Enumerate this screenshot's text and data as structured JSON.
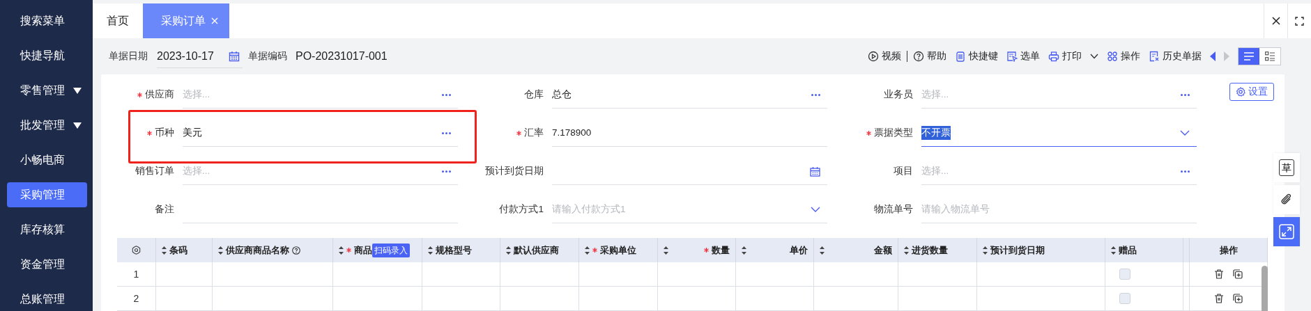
{
  "sidebar": {
    "items": [
      {
        "label": "搜索菜单",
        "selected": false,
        "expandable": false
      },
      {
        "label": "快捷导航",
        "selected": false,
        "expandable": false
      },
      {
        "label": "零售管理",
        "selected": false,
        "expandable": true
      },
      {
        "label": "批发管理",
        "selected": false,
        "expandable": true
      },
      {
        "label": "小畅电商",
        "selected": false,
        "expandable": false
      },
      {
        "label": "采购管理",
        "selected": true,
        "expandable": false
      },
      {
        "label": "库存核算",
        "selected": false,
        "expandable": false
      },
      {
        "label": "资金管理",
        "selected": false,
        "expandable": false
      },
      {
        "label": "总账管理",
        "selected": false,
        "expandable": false
      }
    ]
  },
  "tabs": [
    {
      "label": "首页",
      "selected": false,
      "closable": false
    },
    {
      "label": "采购订单",
      "selected": true,
      "closable": true
    }
  ],
  "document": {
    "date_label": "单据日期",
    "date": "2023-10-17",
    "code_label": "单据编码",
    "code": "PO-20231017-001"
  },
  "toolbar": [
    {
      "kind": "video",
      "label": "视频",
      "dropdown": false
    },
    {
      "kind": "divider"
    },
    {
      "kind": "help",
      "label": "帮助",
      "dropdown": false
    },
    {
      "kind": "shortcut",
      "label": "快捷键",
      "dropdown": false
    },
    {
      "kind": "pick",
      "label": "选单",
      "dropdown": false
    },
    {
      "kind": "print",
      "label": "打印",
      "dropdown": true
    },
    {
      "kind": "operate",
      "label": "操作",
      "dropdown": false
    },
    {
      "kind": "history",
      "label": "历史单据",
      "dropdown": false
    }
  ],
  "pager": {
    "prev_disabled": false,
    "next_disabled": true
  },
  "view_modes": [
    {
      "kind": "list",
      "selected": true
    },
    {
      "kind": "detail",
      "selected": false
    }
  ],
  "settings_button": "设置",
  "form": {
    "fields": [
      {
        "label": "供应商",
        "required": true,
        "kind": "lookup",
        "placeholder": "选择...",
        "highlighted": false,
        "focused": false
      },
      {
        "label": "仓库",
        "required": false,
        "kind": "lookup",
        "value": "总仓",
        "highlighted": false,
        "focused": false
      },
      {
        "label": "业务员",
        "required": false,
        "kind": "lookup",
        "placeholder": "选择...",
        "highlighted": false,
        "focused": false
      },
      {
        "label": "币种",
        "required": true,
        "kind": "lookup",
        "value": "美元",
        "highlighted": true,
        "focused": false
      },
      {
        "label": "汇率",
        "required": true,
        "kind": "text",
        "value": "7.178900",
        "highlighted": false,
        "focused": false
      },
      {
        "label": "票据类型",
        "required": true,
        "kind": "select",
        "value": "不开票",
        "highlighted": false,
        "focused": true
      },
      {
        "label": "销售订单",
        "required": false,
        "kind": "lookup",
        "placeholder": "选择...",
        "highlighted": false,
        "focused": false
      },
      {
        "label": "预计到货日期",
        "required": false,
        "kind": "date",
        "highlighted": false,
        "focused": false
      },
      {
        "label": "项目",
        "required": false,
        "kind": "lookup",
        "placeholder": "选择...",
        "highlighted": false,
        "focused": false
      },
      {
        "label": "备注",
        "required": false,
        "kind": "text",
        "highlighted": false,
        "focused": false
      },
      {
        "label": "付款方式1",
        "required": false,
        "kind": "select",
        "placeholder": "请输入付款方式1",
        "highlighted": false,
        "focused": false
      },
      {
        "label": "物流单号",
        "required": false,
        "kind": "text",
        "placeholder": "请输入物流单号",
        "highlighted": false,
        "focused": false
      }
    ]
  },
  "table": {
    "columns": [
      {
        "label": "条码",
        "sortable": true,
        "required": false,
        "help": false
      },
      {
        "label": "供应商商品名称",
        "sortable": true,
        "required": false,
        "help": true
      },
      {
        "label": "商品",
        "sortable": true,
        "required": true,
        "help": false,
        "badge": "扫码录入"
      },
      {
        "label": "规格型号",
        "sortable": true,
        "required": false,
        "help": false
      },
      {
        "label": "默认供应商",
        "sortable": true,
        "required": false,
        "help": false
      },
      {
        "label": "采购单位",
        "sortable": true,
        "required": true,
        "help": false
      },
      {
        "label": "数量",
        "sortable": true,
        "required": true,
        "help": false
      },
      {
        "label": "单价",
        "sortable": true,
        "required": false,
        "help": false
      },
      {
        "label": "金额",
        "sortable": true,
        "required": false,
        "help": false
      },
      {
        "label": "进货数量",
        "sortable": true,
        "required": false,
        "help": false
      },
      {
        "label": "预计到货日期",
        "sortable": true,
        "required": false,
        "help": false
      },
      {
        "label": "赠品",
        "sortable": true,
        "required": false,
        "help": false
      },
      {
        "label": "操作",
        "sortable": false,
        "required": false,
        "help": false
      }
    ],
    "rows": [
      {
        "index": "1",
        "gift": false
      },
      {
        "index": "2",
        "gift": false
      }
    ]
  },
  "side_tools": {
    "draft_label": "草"
  }
}
